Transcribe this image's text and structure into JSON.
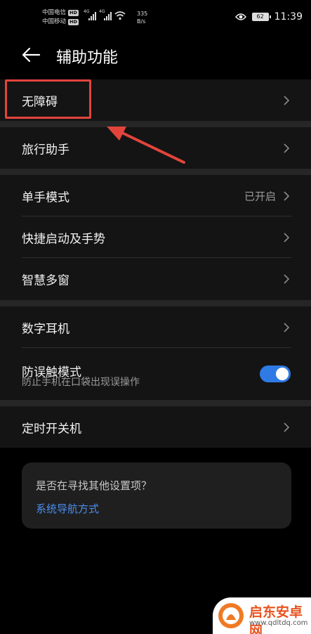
{
  "status": {
    "carrier1": "中国电信",
    "carrier2": "中国移动",
    "hd_label": "HD",
    "net_tag": "4G",
    "speed_value": "335",
    "speed_unit": "B/s",
    "battery": "62",
    "time": "11:39"
  },
  "header": {
    "back_icon": "arrow-left-icon",
    "title": "辅助功能"
  },
  "items": {
    "accessibility": "无障碍",
    "travel_assistant": "旅行助手",
    "one_hand_mode": "单手模式",
    "one_hand_value": "已开启",
    "quick_launch": "快捷启动及手势",
    "smart_multiwindow": "智慧多窗",
    "digital_earphone": "数字耳机",
    "anti_touch": "防误触模式",
    "anti_touch_sub": "防止手机在口袋出现误操作",
    "scheduled_power": "定时开关机"
  },
  "suggest": {
    "question": "是否在寻找其他设置项？",
    "link": "系统导航方式"
  },
  "watermark": {
    "name": "启东安卓网",
    "url": "www.qdltdq.com"
  },
  "colors": {
    "highlight": "#e2443c",
    "toggle_on": "#2f7ae5",
    "link": "#4a8df0"
  }
}
